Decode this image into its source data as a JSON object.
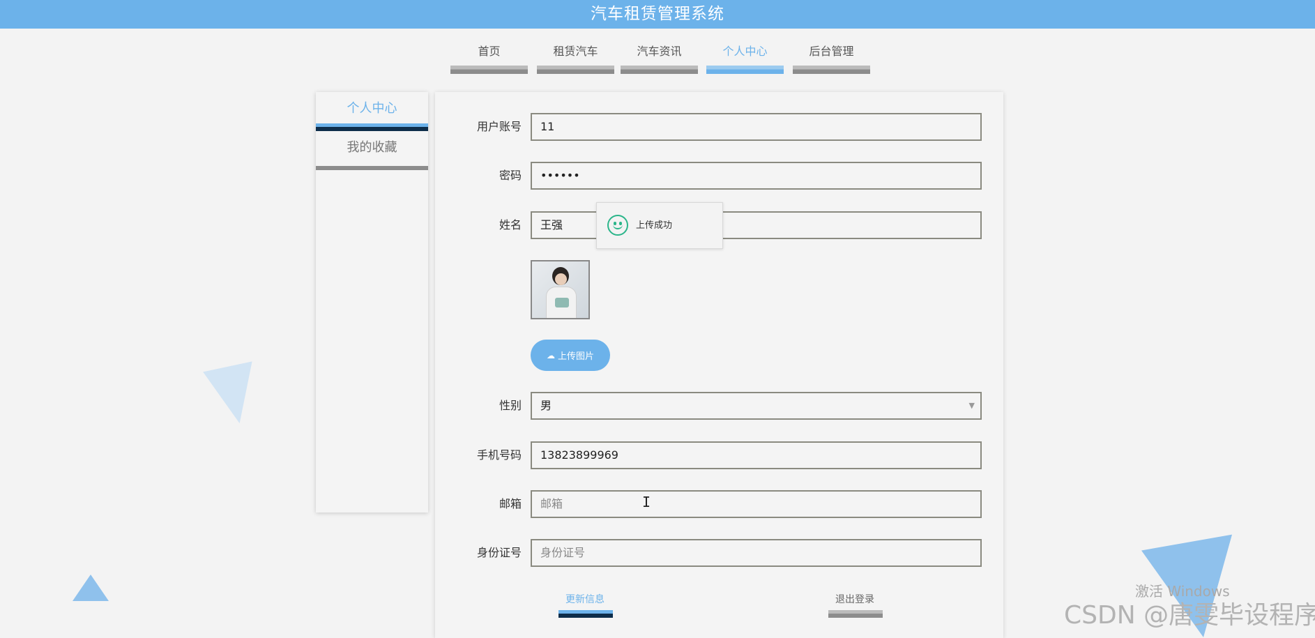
{
  "app": {
    "title": "汽车租赁管理系统",
    "accent": "#6cb2ea",
    "header_bg": "#6cb2ea"
  },
  "nav": {
    "items": [
      {
        "label": "首页",
        "active": false
      },
      {
        "label": "租赁汽车",
        "active": false
      },
      {
        "label": "汽车资讯",
        "active": false
      },
      {
        "label": "个人中心",
        "active": true
      },
      {
        "label": "后台管理",
        "active": false
      }
    ]
  },
  "sidebar": {
    "items": [
      {
        "label": "个人中心",
        "active": true
      },
      {
        "label": "我的收藏",
        "active": false
      }
    ]
  },
  "form": {
    "username": {
      "label": "用户账号",
      "value": "11"
    },
    "password": {
      "label": "密码",
      "value": "••••••"
    },
    "name": {
      "label": "姓名",
      "value": "王强"
    },
    "upload": {
      "icon": "cloud-upload-icon",
      "label": "上传图片"
    },
    "gender": {
      "label": "性别",
      "value": "男",
      "icon": "caret-down-icon"
    },
    "phone": {
      "label": "手机号码",
      "value": "13823899969"
    },
    "email": {
      "label": "邮箱",
      "value": "",
      "placeholder": "邮箱"
    },
    "idcard": {
      "label": "身份证号",
      "value": "",
      "placeholder": "身份证号"
    }
  },
  "actions": {
    "update": "更新信息",
    "logout": "退出登录"
  },
  "toast": {
    "message": "上传成功",
    "icon": "smile-icon",
    "color": "#2bb58a"
  },
  "watermarks": {
    "windows": "激活 Windows",
    "csdn": "CSDN @唐雯毕设程序"
  }
}
